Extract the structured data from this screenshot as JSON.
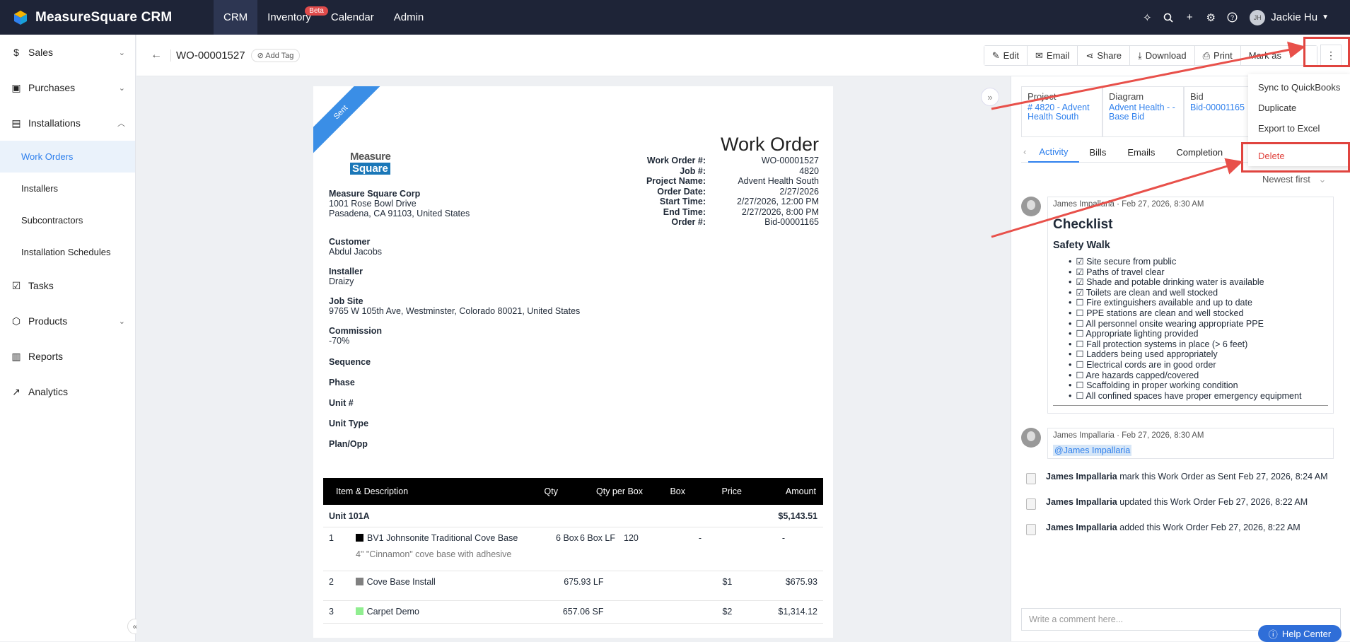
{
  "app": {
    "title": "MeasureSquare CRM"
  },
  "nav": [
    {
      "label": "CRM",
      "active": true
    },
    {
      "label": "Inventory",
      "badge": "Beta"
    },
    {
      "label": "Calendar"
    },
    {
      "label": "Admin"
    }
  ],
  "user": {
    "initials": "JH",
    "name": "Jackie Hu"
  },
  "sidebar": {
    "sales": "Sales",
    "purchases": "Purchases",
    "installations": "Installations",
    "work_orders": "Work Orders",
    "installers": "Installers",
    "subcontractors": "Subcontractors",
    "installation_schedules": "Installation Schedules",
    "tasks": "Tasks",
    "products": "Products",
    "reports": "Reports",
    "analytics": "Analytics"
  },
  "header": {
    "title": "WO-00001527",
    "add_tag": "Add Tag",
    "edit": "Edit",
    "email": "Email",
    "share": "Share",
    "download": "Download",
    "print": "Print",
    "mark_as": "Mark as"
  },
  "dropdown": {
    "sync": "Sync to QuickBooks",
    "duplicate": "Duplicate",
    "export": "Export to Excel",
    "delete": "Delete"
  },
  "doc": {
    "ribbon": "Sent",
    "logo_top": "Measure",
    "logo_bottom": "Square",
    "company_name": "Measure Square Corp",
    "company_addr1": "1001 Rose Bowl Drive",
    "company_addr2": "Pasadena, CA 91103, United States",
    "heading": "Work Order",
    "meta": {
      "wo_label": "Work Order #:",
      "wo": "WO-00001527",
      "job_label": "Job #:",
      "job": "4820",
      "project_label": "Project Name:",
      "project": "Advent Health South",
      "order_date_label": "Order Date:",
      "order_date": "2/27/2026",
      "start_label": "Start Time:",
      "start": "2/27/2026, 12:00 PM",
      "end_label": "End Time:",
      "end": "2/27/2026, 8:00 PM",
      "order_label": "Order #:",
      "order": "Bid-00001165"
    },
    "customer_label": "Customer",
    "customer": "Abdul Jacobs",
    "installer_label": "Installer",
    "installer": "Draizy",
    "jobsite_label": "Job Site",
    "jobsite": "9765 W 105th Ave, Westminster, Colorado 80021, United States",
    "commission_label": "Commission",
    "commission": "-70%",
    "sequence_label": "Sequence",
    "phase_label": "Phase",
    "unit_label": "Unit #",
    "unit_type_label": "Unit Type",
    "plan_label": "Plan/Opp",
    "table": {
      "h_item": "Item & Description",
      "h_qty": "Qty",
      "h_qpb": "Qty per Box",
      "h_box": "Box",
      "h_price": "Price",
      "h_amount": "Amount",
      "unit_name": "Unit 101A",
      "unit_total": "$5,143.51",
      "rows": [
        {
          "n": "1",
          "name": "BV1 Johnsonite Traditional Cove Base",
          "desc": "4\" \"Cinnamon\" cove base with adhesive",
          "qty": "6 Box",
          "qpb": "6 Box LF",
          "box": "120",
          "price": "-",
          "amount": "-",
          "color": "#000000"
        },
        {
          "n": "2",
          "name": "Cove Base Install",
          "qty": "675.93 LF",
          "price": "$1",
          "amount": "$675.93",
          "color": "#808080"
        },
        {
          "n": "3",
          "name": "Carpet Demo",
          "qty": "657.06 SF",
          "price": "$2",
          "amount": "$1,314.12",
          "color": "#90ee90"
        }
      ]
    }
  },
  "panel": {
    "project_label": "Project",
    "project_value": "# 4820 - Advent Health South",
    "diagram_label": "Diagram",
    "diagram_value": "Advent Health - - Base Bid",
    "bid_label": "Bid",
    "bid_value": "Bid-00001165",
    "tabs": [
      "Activity",
      "Bills",
      "Emails",
      "Completion"
    ],
    "sort": "Newest first",
    "note1_meta": "James Impallaria · Feb 27, 2026, 8:30 AM",
    "checklist_title": "Checklist",
    "checklist_sub": "Safety Walk",
    "checklist": [
      "☑ Site secure from public",
      "☑ Paths of travel clear",
      "☑ Shade and potable drinking water is available",
      "☑ Toilets are clean and well stocked",
      "☐ Fire extinguishers available and up to date",
      "☐ PPE stations are clean and well stocked",
      "☐ All personnel onsite wearing appropriate PPE",
      "☐ Appropriate lighting provided",
      "☐ Fall protection systems in place (> 6 feet)",
      "☐ Ladders being used appropriately",
      "☐ Electrical cords are in good order",
      "☐ Are hazards capped/covered",
      "☐ Scaffolding in proper working condition",
      "☐ All confined spaces have proper emergency equipment"
    ],
    "note2_meta": "James Impallaria · Feb 27, 2026, 8:30 AM",
    "mention": "@James Impallaria",
    "sys1_user": "James Impallaria",
    "sys1_text": " mark this Work Order as Sent Feb 27, 2026, 8:24 AM",
    "sys2_user": "James Impallaria",
    "sys2_text": " updated this Work Order Feb 27, 2026, 8:22 AM",
    "sys3_user": "James Impallaria",
    "sys3_text": " added this Work Order Feb 27, 2026, 8:22 AM",
    "comment_placeholder": "Write a comment here...",
    "help": "Help Center"
  },
  "colors": {
    "topbar": "#1e2437",
    "accent": "#2f80ed",
    "annotation_red": "#e0443f"
  }
}
